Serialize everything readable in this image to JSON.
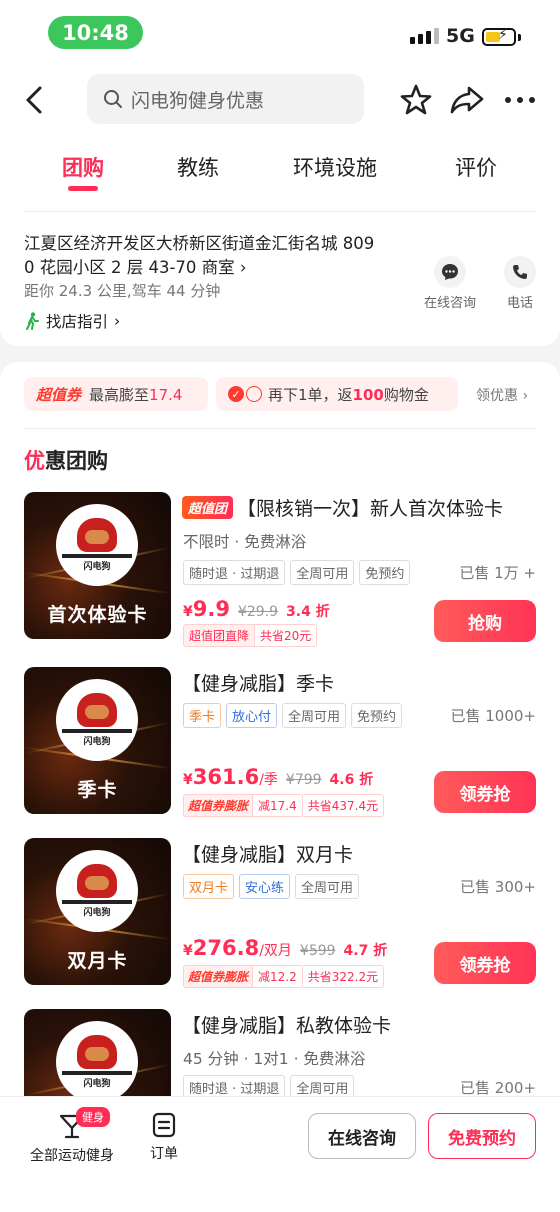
{
  "status_bar": {
    "time": "10:48",
    "network": "5G"
  },
  "search": {
    "placeholder": "闪电狗健身优惠"
  },
  "tabs": [
    {
      "label": "团购",
      "active": true
    },
    {
      "label": "教练",
      "active": false
    },
    {
      "label": "环境设施",
      "active": false
    },
    {
      "label": "评价",
      "active": false
    }
  ],
  "address": {
    "line1": "江夏区经济开发区大桥新区街道金汇街名城 809",
    "line2": "0 花园小区 2 层 43-70 商室",
    "distance": "距你 24.3 公里,驾车 44 分钟",
    "guide": "找店指引",
    "consult_label": "在线咨询",
    "phone_label": "电话"
  },
  "promos": {
    "brand": "超值券",
    "promo1_text": "最高膨至",
    "promo1_value": "17.4",
    "promo2_prefix": "再下1单，返",
    "promo2_value": "100",
    "promo2_suffix": "购物金",
    "link": "领优惠"
  },
  "section": {
    "title_accent": "优",
    "title_rest": "惠团购"
  },
  "deals": [
    {
      "thumb_caption": "首次体验卡",
      "badge": "超值团",
      "title": "【限核销一次】新人首次体验卡",
      "subtitle": "不限时 · 免费淋浴",
      "tags": [
        "随时退 · 过期退",
        "全周可用",
        "免预约"
      ],
      "sold": "已售 1万 +",
      "price": "9.9",
      "unit": "",
      "orig": "¥29.9",
      "discount": "3.4 折",
      "save_a": "超值团直降",
      "save_b": "共省20元",
      "button": "抢购"
    },
    {
      "thumb_caption": "季卡",
      "title": "【健身减脂】季卡",
      "tags": [
        "季卡",
        "放心付",
        "全周可用",
        "免预约"
      ],
      "sold": "已售 1000+",
      "price": "361.6",
      "unit": "/季",
      "orig": "¥799",
      "discount": "4.6 折",
      "save_brand": "超值券膨胀",
      "save_a": "减17.4",
      "save_b": "共省437.4元",
      "button": "领券抢"
    },
    {
      "thumb_caption": "双月卡",
      "title": "【健身减脂】双月卡",
      "tags": [
        "双月卡",
        "安心练",
        "全周可用"
      ],
      "sold": "已售 300+",
      "price": "276.8",
      "unit": "/双月",
      "orig": "¥599",
      "discount": "4.7 折",
      "save_brand": "超值券膨胀",
      "save_a": "减12.2",
      "save_b": "共省322.2元",
      "button": "领券抢"
    },
    {
      "title": "【健身减脂】私教体验卡",
      "subtitle": "45 分钟 · 1对1 · 免费淋浴",
      "tags": [
        "随时退 · 过期退",
        "全周可用"
      ],
      "sold": "已售 200+"
    }
  ],
  "bottom_nav": {
    "badge": "健身",
    "all_label": "全部运动健身",
    "orders_label": "订单",
    "consult_button": "在线咨询",
    "book_button": "免费预约"
  },
  "colors": {
    "accent": "#ff2d55",
    "time_pill": "#3cc65c",
    "tag_orange": "#f07c1f",
    "tag_blue": "#2f6fd6"
  },
  "icons": [
    "back-arrow-icon",
    "search-icon",
    "star-icon",
    "share-icon",
    "more-icon",
    "chat-icon",
    "phone-icon",
    "walking-icon",
    "cocktail-icon",
    "order-icon"
  ]
}
